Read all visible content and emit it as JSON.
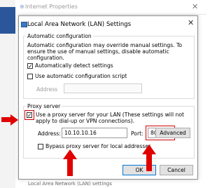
{
  "background": {
    "window_title": "Internet Properties",
    "bottom_text": "Local Area Network (LAN) settings"
  },
  "dialog": {
    "title": "Local Area Network (LAN) Settings",
    "auto_config": {
      "heading": "Automatic configuration",
      "description": "Automatic configuration may override manual settings.  To ensure the use of manual settings, disable automatic configuration.",
      "detect_label": "Automatically detect settings",
      "detect_checked": true,
      "script_label": "Use automatic configuration script",
      "script_checked": false,
      "address_label": "Address",
      "address_value": ""
    },
    "proxy": {
      "heading": "Proxy server",
      "use_proxy_label": "Use a proxy server for your LAN (These settings will not apply to dial-up or VPN connections).",
      "use_proxy_checked": true,
      "address_label": "Address:",
      "address_value": "10.10.10.16",
      "port_label": "Port:",
      "port_value": "8080",
      "advanced_label": "Advanced",
      "bypass_label": "Bypass proxy server for local addresses",
      "bypass_checked": false
    },
    "ok_label": "OK",
    "cancel_label": "Cancel"
  },
  "colors": {
    "annotation_red": "#e00000",
    "default_button_border": "#0078d7"
  }
}
